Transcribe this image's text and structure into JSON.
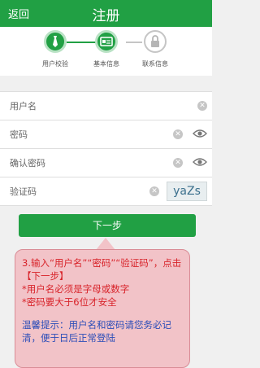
{
  "header": {
    "back_label": "返回",
    "title": "注册"
  },
  "steps": [
    {
      "label": "用户校验",
      "state": "done",
      "icon": "tie-icon"
    },
    {
      "label": "基本信息",
      "state": "current",
      "icon": "id-card-icon"
    },
    {
      "label": "联系信息",
      "state": "todo",
      "icon": "lock-icon"
    }
  ],
  "form": {
    "username_placeholder": "用户名",
    "password_placeholder": "密码",
    "confirm_placeholder": "确认密码",
    "captcha_placeholder": "验证码",
    "captcha_text": "yaZs"
  },
  "next_label": "下一步",
  "annotation": {
    "instruction": "3.输入“用户名”“密码”“验证码”，点击【下一步】\n*用户名必须是字母或数字\n*密码要大于6位才安全",
    "tip": "温馨提示：用户名和密码请您务必记清，便于日后正常登陆"
  },
  "colors": {
    "brand_green": "#21a044",
    "bubble_bg": "#f2c3c8",
    "instruction_red": "#d8232a",
    "tip_blue": "#2b4db8"
  }
}
